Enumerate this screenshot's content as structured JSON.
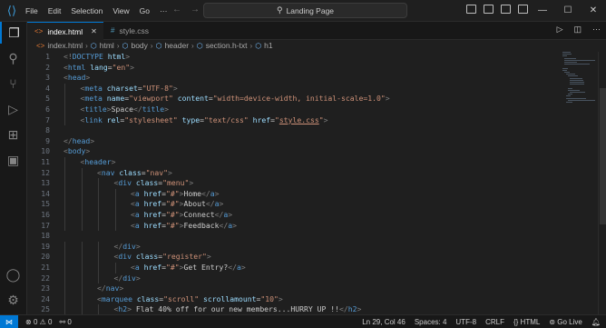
{
  "menu": [
    "File",
    "Edit",
    "Selection",
    "View",
    "Go"
  ],
  "command_center": {
    "label": "Landing Page"
  },
  "tabs": [
    {
      "label": "index.html",
      "active": true
    },
    {
      "label": "style.css",
      "active": false
    }
  ],
  "breadcrumb": [
    "index.html",
    "html",
    "body",
    "header",
    "section.h-txt",
    "h1"
  ],
  "code_lines": [
    {
      "n": "1",
      "html": "<span class='p'>&lt;!</span><span class='t'>DOCTYPE</span> <span class='a'>html</span><span class='p'>&gt;</span>",
      "indent": 0
    },
    {
      "n": "2",
      "html": "<span class='p'>&lt;</span><span class='t'>html</span> <span class='a'>lang</span><span class='txt'>=</span><span class='s'>\"en\"</span><span class='p'>&gt;</span>",
      "indent": 0
    },
    {
      "n": "3",
      "html": "<span class='p'>&lt;</span><span class='t'>head</span><span class='p'>&gt;</span>",
      "indent": 0
    },
    {
      "n": "4",
      "html": "<span class='p'>&lt;</span><span class='t'>meta</span> <span class='a'>charset</span><span class='txt'>=</span><span class='s'>\"UTF-8\"</span><span class='p'>&gt;</span>",
      "indent": 1
    },
    {
      "n": "5",
      "html": "<span class='p'>&lt;</span><span class='t'>meta</span> <span class='a'>name</span><span class='txt'>=</span><span class='s'>\"viewport\"</span> <span class='a'>content</span><span class='txt'>=</span><span class='s'>\"width=device-width, initial-scale=1.0\"</span><span class='p'>&gt;</span>",
      "indent": 1
    },
    {
      "n": "6",
      "html": "<span class='p'>&lt;</span><span class='t'>title</span><span class='p'>&gt;</span><span class='txt'>Space</span><span class='p'>&lt;/</span><span class='t'>title</span><span class='p'>&gt;</span>",
      "indent": 1
    },
    {
      "n": "7",
      "html": "<span class='p'>&lt;</span><span class='t'>link</span> <span class='a'>rel</span><span class='txt'>=</span><span class='s'>\"stylesheet\"</span> <span class='a'>type</span><span class='txt'>=</span><span class='s'>\"text/css\"</span> <span class='a'>href</span><span class='txt'>=</span><span class='s'>\"<span class='u'>style.css</span>\"</span><span class='p'>&gt;</span>",
      "indent": 1
    },
    {
      "n": "8",
      "html": "",
      "indent": 0
    },
    {
      "n": "9",
      "html": "<span class='p'>&lt;/</span><span class='t'>head</span><span class='p'>&gt;</span>",
      "indent": 0
    },
    {
      "n": "10",
      "html": "<span class='p'>&lt;</span><span class='t'>body</span><span class='p'>&gt;</span>",
      "indent": 0
    },
    {
      "n": "11",
      "html": "<span class='p'>&lt;</span><span class='t'>header</span><span class='p'>&gt;</span>",
      "indent": 1
    },
    {
      "n": "12",
      "html": "<span class='p'>&lt;</span><span class='t'>nav</span> <span class='a'>class</span><span class='txt'>=</span><span class='s'>\"nav\"</span><span class='p'>&gt;</span>",
      "indent": 2
    },
    {
      "n": "13",
      "html": "<span class='p'>&lt;</span><span class='t'>div</span> <span class='a'>class</span><span class='txt'>=</span><span class='s'>\"menu\"</span><span class='p'>&gt;</span>",
      "indent": 3
    },
    {
      "n": "14",
      "html": "<span class='p'>&lt;</span><span class='t'>a</span> <span class='a'>href</span><span class='txt'>=</span><span class='s'>\"#\"</span><span class='p'>&gt;</span><span class='txt'>Home</span><span class='p'>&lt;/</span><span class='t'>a</span><span class='p'>&gt;</span>",
      "indent": 4
    },
    {
      "n": "15",
      "html": "<span class='p'>&lt;</span><span class='t'>a</span> <span class='a'>href</span><span class='txt'>=</span><span class='s'>\"#\"</span><span class='p'>&gt;</span><span class='txt'>About</span><span class='p'>&lt;/</span><span class='t'>a</span><span class='p'>&gt;</span>",
      "indent": 4
    },
    {
      "n": "16",
      "html": "<span class='p'>&lt;</span><span class='t'>a</span> <span class='a'>href</span><span class='txt'>=</span><span class='s'>\"#\"</span><span class='p'>&gt;</span><span class='txt'>Connect</span><span class='p'>&lt;/</span><span class='t'>a</span><span class='p'>&gt;</span>",
      "indent": 4
    },
    {
      "n": "17",
      "html": "<span class='p'>&lt;</span><span class='t'>a</span> <span class='a'>href</span><span class='txt'>=</span><span class='s'>\"#\"</span><span class='p'>&gt;</span><span class='txt'>Feedback</span><span class='p'>&lt;/</span><span class='t'>a</span><span class='p'>&gt;</span>",
      "indent": 4
    },
    {
      "n": "18",
      "html": "",
      "indent": 0
    },
    {
      "n": "19",
      "html": "<span class='p'>&lt;/</span><span class='t'>div</span><span class='p'>&gt;</span>",
      "indent": 3
    },
    {
      "n": "20",
      "html": "<span class='p'>&lt;</span><span class='t'>div</span> <span class='a'>class</span><span class='txt'>=</span><span class='s'>\"register\"</span><span class='p'>&gt;</span>",
      "indent": 3
    },
    {
      "n": "21",
      "html": "<span class='p'>&lt;</span><span class='t'>a</span> <span class='a'>href</span><span class='txt'>=</span><span class='s'>\"#\"</span><span class='p'>&gt;</span><span class='txt'>Get Entry?</span><span class='p'>&lt;/</span><span class='t'>a</span><span class='p'>&gt;</span>",
      "indent": 4
    },
    {
      "n": "22",
      "html": "<span class='p'>&lt;/</span><span class='t'>div</span><span class='p'>&gt;</span>",
      "indent": 3
    },
    {
      "n": "23",
      "html": "<span class='p'>&lt;/</span><span class='t'>nav</span><span class='p'>&gt;</span>",
      "indent": 2
    },
    {
      "n": "24",
      "html": "<span class='p'>&lt;</span><span class='t'>marquee</span> <span class='a'>class</span><span class='txt'>=</span><span class='s'>\"scroll\"</span> <span class='a'>scrollamount</span><span class='txt'>=</span><span class='s'>\"10\"</span><span class='p'>&gt;</span>",
      "indent": 2
    },
    {
      "n": "25",
      "html": "<span class='p'>&lt;</span><span class='t'>h2</span><span class='p'>&gt;</span><span class='txt'> Flat 40% off for our new members...HURRY UP !!</span><span class='p'>&lt;/</span><span class='t'>h2</span><span class='p'>&gt;</span>",
      "indent": 3
    },
    {
      "n": "26",
      "html": "<span class='p'>&lt;/</span><span class='t'>marquee</span><span class='p'>&gt;</span>",
      "indent": 2
    }
  ],
  "status": {
    "errors": "0",
    "warnings": "0",
    "ports": "0",
    "position": "Ln 29, Col 46",
    "spaces": "Spaces: 4",
    "encoding": "UTF-8",
    "eol": "CRLF",
    "language": "HTML",
    "golive": "Go Live"
  }
}
